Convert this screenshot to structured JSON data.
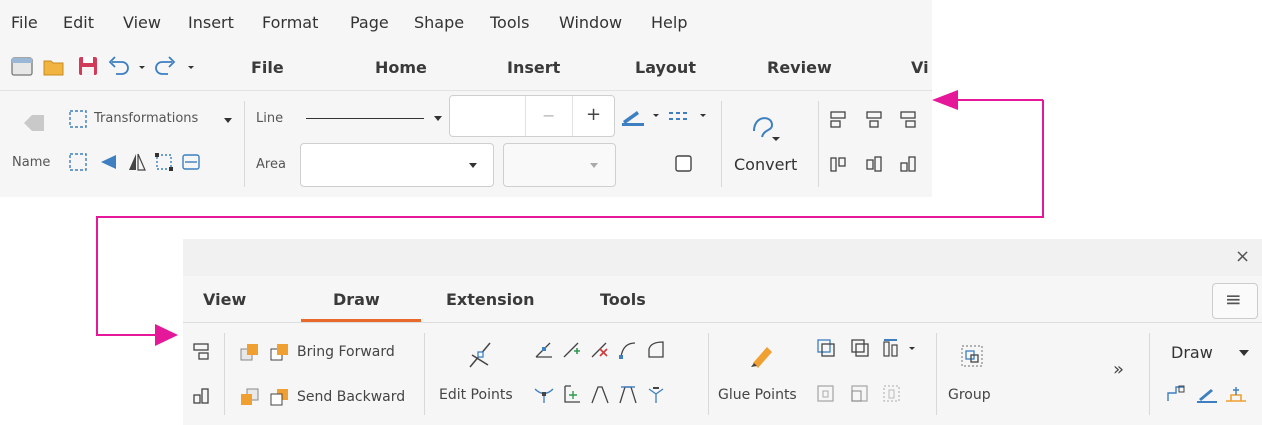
{
  "menubar": {
    "items": [
      "File",
      "Edit",
      "View",
      "Insert",
      "Format",
      "Page",
      "Shape",
      "Tools",
      "Window",
      "Help"
    ]
  },
  "top_tabs": [
    "File",
    "Home",
    "Insert",
    "Layout",
    "Review",
    "Vi"
  ],
  "top_ribbon": {
    "transformations": "Transformations",
    "name": "Name",
    "line": "Line",
    "area": "Area",
    "minus": "−",
    "plus": "+",
    "convert": "Convert"
  },
  "bottom_tabs": [
    "View",
    "Draw",
    "Extension",
    "Tools"
  ],
  "bottom_ribbon": {
    "close": "×",
    "menu": "≡",
    "bring_forward": "Bring Forward",
    "send_backward": "Send Backward",
    "edit_points": "Edit Points",
    "glue_points": "Glue Points",
    "group": "Group",
    "more": "»",
    "draw_dropdown": "Draw"
  },
  "colors": {
    "accent_pink": "#e6189a",
    "active_tab_underline": "#e8692c",
    "icon_blue": "#3d7fc1",
    "icon_orange": "#f0a030",
    "icon_red": "#d23a3a"
  }
}
